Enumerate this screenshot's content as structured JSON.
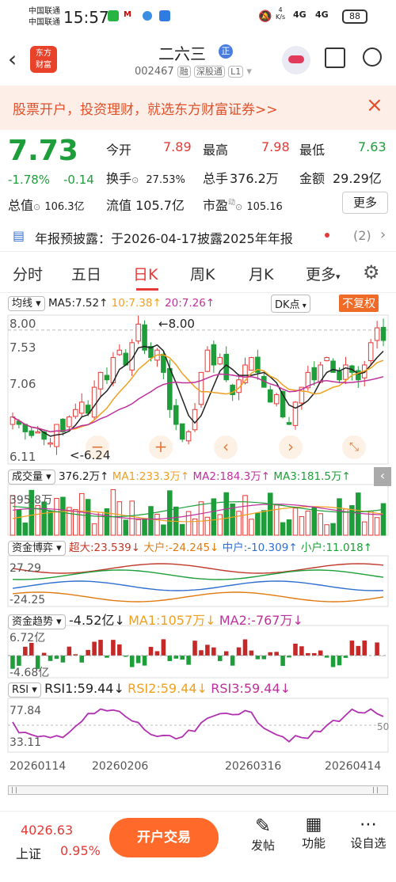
{
  "status": {
    "carrier1": "中国联通",
    "carrier2": "中国联通",
    "time": "15:57",
    "speed": "4\nK/s",
    "net1": "4G",
    "net2": "4G",
    "battery": "88"
  },
  "header": {
    "title": "二六三",
    "badge": "正",
    "code": "002467",
    "tags": [
      "融",
      "深股通",
      "L1"
    ]
  },
  "banner": {
    "text": "股票开户，投资理财，就选东方财富证券>>"
  },
  "quote": {
    "price": "7.73",
    "change_pct": "-1.78%",
    "change": "-0.14",
    "open_label": "今开",
    "open": "7.89",
    "high_label": "最高",
    "high": "7.98",
    "low_label": "最低",
    "low": "7.63",
    "turnover_label": "换手",
    "turnover": "27.53%",
    "volume_label": "总手",
    "volume": "376.2万",
    "amount_label": "金额",
    "amount": "29.29亿",
    "mktcap_label": "总值",
    "mktcap": "106.3亿",
    "float_label": "流值",
    "float": "105.7亿",
    "pe_label": "市盈",
    "pe_sup": "动",
    "pe": "105.16",
    "more": "更多"
  },
  "notice": {
    "text": "年报预披露：于2026-04-17披露2025年年报",
    "count": "(2)"
  },
  "tabs": [
    "分时",
    "五日",
    "日K",
    "周K",
    "月K",
    "更多"
  ],
  "active_tab": "日K",
  "chart_header": {
    "ma_select": "均线",
    "ma5": "MA5:7.52↑",
    "ma10": "10:7.38↑",
    "ma20": "20:7.26↑",
    "dk": "DK点",
    "adjust": "不复权",
    "price_top": "8.00",
    "price_mid": "7.53",
    "price_low": "7.06",
    "price_bottom": "6.11",
    "max_label": "←8.00",
    "min_label": "<-6.24"
  },
  "volume_header": {
    "select": "成交量",
    "value": "376.2万↑",
    "ma1": "MA1:233.3万↑",
    "ma2": "MA2:184.3万↑",
    "ma3": "MA3:181.5万↑",
    "top": "395.8万"
  },
  "fund_game_header": {
    "select": "资金博弈",
    "super": "超大:23.539↓",
    "big": "大户:-24.245↓",
    "mid": "中户:-10.309↑",
    "small": "小户:11.018↑",
    "top": "27.29",
    "bottom": "-24.25"
  },
  "fund_trend_header": {
    "select": "资金趋势",
    "value": "-4.52亿↓",
    "ma1": "MA1:1057万↓",
    "ma2": "MA2:-767万↓",
    "top": "6.72亿",
    "bottom": "-4.68亿"
  },
  "rsi_header": {
    "select": "RSI",
    "rsi1": "RSI1:59.44↓",
    "rsi2": "RSI2:59.44↓",
    "rsi3": "RSI3:59.44↓",
    "top": "77.84",
    "bottom": "33.11",
    "right": "50"
  },
  "dates": [
    "20260114",
    "20260206",
    "20260316",
    "20260414"
  ],
  "footer": {
    "index_value": "4026.63",
    "index_name": "上证",
    "index_pct": "0.95%",
    "trade_btn": "开户交易",
    "post": "发帖",
    "func": "功能",
    "custom": "设自选"
  },
  "colors": {
    "up": "#e53935",
    "down": "#1e9e3a",
    "ma5": "#222222",
    "ma10": "#f0a020",
    "ma20": "#c0309a",
    "accent": "#ff6a2a"
  },
  "chart_data": {
    "type": "candlestick",
    "title": "",
    "price_range": [
      6.11,
      8.0
    ],
    "ma": {
      "MA5": 7.52,
      "MA10": 7.38,
      "MA20": 7.26
    },
    "max_price": 8.0,
    "min_price": 6.24,
    "last_close": 7.73,
    "volume_range": [
      0,
      395.8
    ],
    "rsi_range": [
      33.11,
      77.84
    ],
    "x_ticks": [
      "20260114",
      "20260206",
      "20260316",
      "20260414"
    ]
  }
}
